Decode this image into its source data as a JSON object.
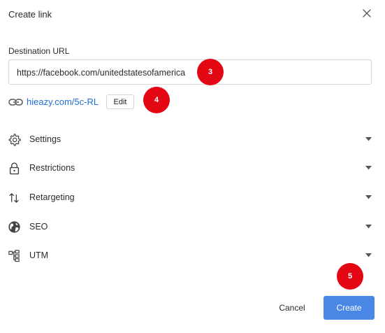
{
  "dialog": {
    "title": "Create link",
    "close_icon": "close-icon"
  },
  "destination": {
    "label": "Destination URL",
    "value": "https://facebook.com/unitedstatesofamerica"
  },
  "short_link": {
    "icon": "link-icon",
    "text": "hieazy.com/5c-RL",
    "edit_label": "Edit"
  },
  "sections": [
    {
      "label": "Settings",
      "icon": "gear-icon"
    },
    {
      "label": "Restrictions",
      "icon": "lock-icon"
    },
    {
      "label": "Retargeting",
      "icon": "arrows-up-down-icon"
    },
    {
      "label": "SEO",
      "icon": "globe-icon"
    },
    {
      "label": "UTM",
      "icon": "tree-structure-icon"
    }
  ],
  "markers": [
    "3",
    "4",
    "5"
  ],
  "footer": {
    "cancel_label": "Cancel",
    "create_label": "Create"
  },
  "colors": {
    "accent": "#4a88e8",
    "link": "#1f6fd6",
    "marker": "#e30613"
  }
}
